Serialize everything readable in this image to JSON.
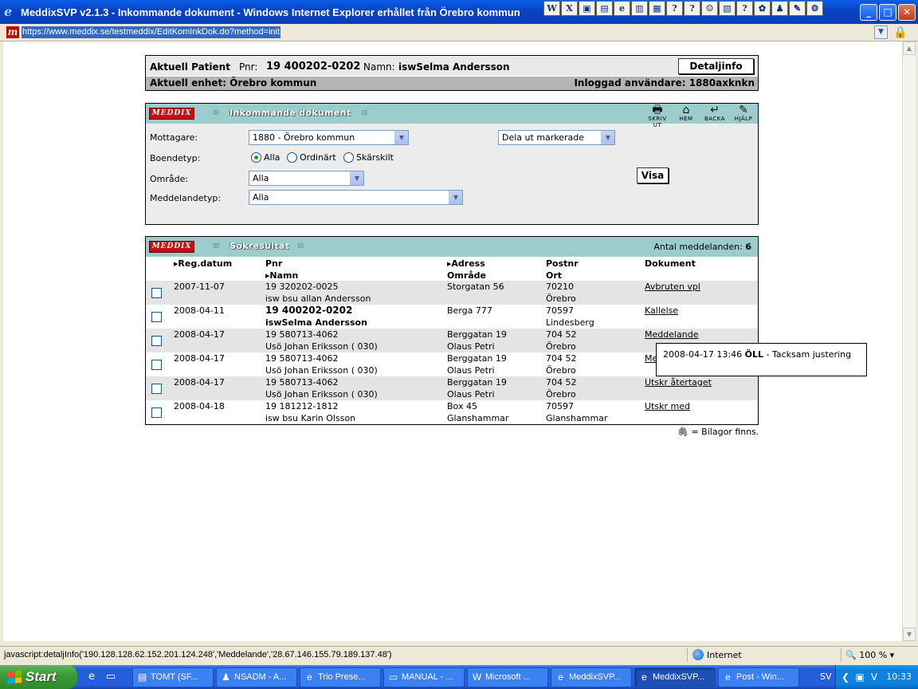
{
  "window": {
    "title": "MeddixSVP v2.1.3 - Inkommande dokument - Windows Internet Explorer erhållet från Örebro kommun",
    "url": "https://www.meddix.se/testmeddix/EditKomInkDok.do?method=init",
    "toolbar_icons": [
      "W",
      "X",
      "▣",
      "▤",
      "e",
      "▥",
      "▦",
      "?",
      "?",
      "☺",
      "▧",
      "?",
      "✿",
      "♟",
      "✎",
      "⚙"
    ]
  },
  "patient": {
    "title": "Aktuell Patient",
    "pnr_label": "Pnr:",
    "pnr_value": "19 400202-0202",
    "name_label": "Namn:",
    "name_value": "iswSelma Andersson",
    "details_button": "Detaljinfo",
    "unit_text": "Aktuell enhet: Örebro kommun",
    "user_text": "Inloggad användare: 1880axknkn"
  },
  "search_panel": {
    "logo": "MEDDIX",
    "title": "Inkommande dokument",
    "tools": [
      {
        "icon": "🖶",
        "label": "SKRIV UT",
        "name": "print"
      },
      {
        "icon": "⌂",
        "label": "HEM",
        "name": "home"
      },
      {
        "icon": "↵",
        "label": "BACKA",
        "name": "back"
      },
      {
        "icon": "✎",
        "label": "HJÄLP",
        "name": "help"
      }
    ],
    "mottagare_label": "Mottagare:",
    "mottagare_value": "1880 - Örebro kommun",
    "action_value": "Dela ut markerade",
    "boendetyp_label": "Boendetyp:",
    "radios": [
      "Alla",
      "Ordinärt",
      "Skärskilt"
    ],
    "omrade_label": "Område:",
    "omrade_value": "Alla",
    "meddelandetyp_label": "Meddelandetyp:",
    "meddelandetyp_value": "Alla",
    "visa_button": "Visa"
  },
  "result_panel": {
    "logo": "MEDDIX",
    "title": "Sökresultat",
    "count_label": "Antal meddelanden:",
    "count_value": "6",
    "headers": {
      "regdatum": "Reg.datum",
      "pnr": "Pnr",
      "namn": "Namn",
      "adress": "Adress",
      "omrade": "Område",
      "postnr": "Postnr",
      "ort": "Ort",
      "dokument": "Dokument"
    },
    "rows": [
      {
        "date": "2007-11-07",
        "pnr": "19 320202-0025",
        "name": "isw bsu allan Andersson",
        "address": "Storgatan 56",
        "area": "",
        "postnr": "70210",
        "ort": "Örebro",
        "doc": "Avbruten vpl"
      },
      {
        "date": "2008-04-11",
        "pnr": "19 400202-0202",
        "name": "iswSelma Andersson",
        "address": "Berga 777",
        "area": "",
        "postnr": "70597",
        "ort": "Lindesberg",
        "doc": "Kallelse"
      },
      {
        "date": "2008-04-17",
        "pnr": "19 580713-4062",
        "name": "Usö Johan Eriksson ( 030)",
        "address": "Berggatan 19",
        "area": "Olaus Petri",
        "postnr": "704 52",
        "ort": "Örebro",
        "doc": "Meddelande"
      },
      {
        "date": "2008-04-17",
        "pnr": "19 580713-4062",
        "name": "Usö Johan Eriksson ( 030)",
        "address": "Berggatan 19",
        "area": "Olaus Petri",
        "postnr": "704 52",
        "ort": "Örebro",
        "doc": "Me"
      },
      {
        "date": "2008-04-17",
        "pnr": "19 580713-4062",
        "name": "Usö Johan Eriksson ( 030)",
        "address": "Berggatan 19",
        "area": "Olaus Petri",
        "postnr": "704 52",
        "ort": "Örebro",
        "doc": "Utskr återtaget"
      },
      {
        "date": "2008-04-18",
        "pnr": "19 181212-1812",
        "name": "isw bsu Karin Olsson",
        "address": "Box 45",
        "area": "Glanshammar",
        "postnr": "70597",
        "ort": "Glanshammar",
        "doc": "Utskr med"
      }
    ],
    "attachment_note": "= Bilagor finns."
  },
  "tooltip": {
    "prefix": "2008-04-17 13:46",
    "bold": "ÖLL",
    "suffix": "- Tacksam justering"
  },
  "statusbar": {
    "text": "javascript:detaljInfo('190.128.128.62.152.201.124.248','Meddelande','28.67.146.155.79.189.137.48')",
    "zone": "Internet",
    "zoom": "100 %"
  },
  "taskbar": {
    "start": "Start",
    "tasks": [
      {
        "label": "TOMT (SF...",
        "icon": "▤"
      },
      {
        "label": "NSADM - A...",
        "icon": "♟"
      },
      {
        "label": "Trio Prese...",
        "icon": "e"
      },
      {
        "label": "MANUAL - ...",
        "icon": "▭"
      },
      {
        "label": "Microsoft ...",
        "icon": "W"
      },
      {
        "label": "MeddixSVP...",
        "icon": "e"
      },
      {
        "label": "MeddixSVP...",
        "icon": "e"
      },
      {
        "label": "Post - Win...",
        "icon": "e"
      }
    ],
    "lang": "SV",
    "time": "10:33"
  }
}
